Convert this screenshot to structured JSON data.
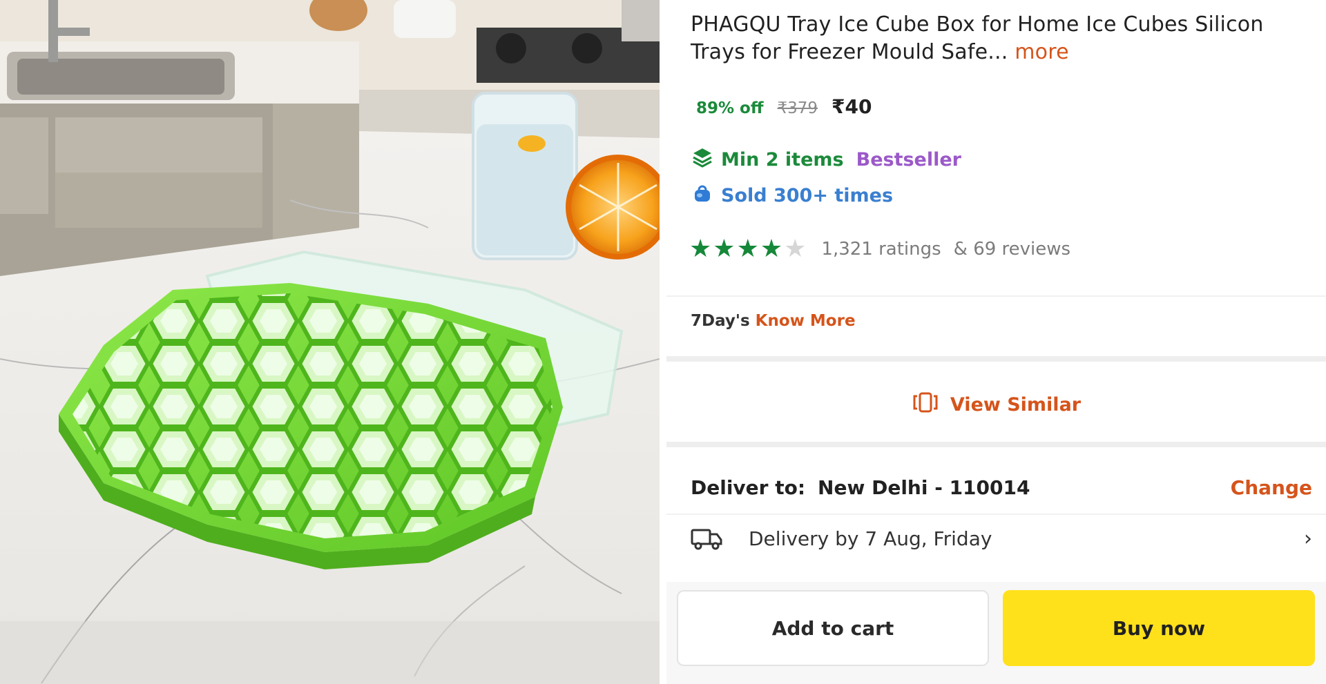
{
  "product": {
    "title": "PHAGQU Tray Ice Cube Box for Home Ice Cubes Silicon Trays for Freezer Mould Safe...",
    "more_label": "more",
    "image_alt": "Green honeycomb silicone ice cube tray on a marble kitchen counter"
  },
  "pricing": {
    "discount": "89% off",
    "mrp": "₹379",
    "price": "₹40"
  },
  "tags": {
    "min_items": "Min 2 items",
    "bestseller": "Bestseller",
    "sold": "Sold 300+ times"
  },
  "rating": {
    "stars": 4,
    "max_stars": 5,
    "ratings_count": "1,321 ratings",
    "reviews_count": "& 69 reviews"
  },
  "return_policy": {
    "label": "7Day's",
    "link": "Know More"
  },
  "view_similar": {
    "label": "View Similar",
    "icon": "view-similar-icon"
  },
  "delivery": {
    "deliver_to_label": "Deliver to:",
    "address": "New Delhi - 110014",
    "change_label": "Change",
    "date_text": "Delivery by 7 Aug, Friday",
    "icon": "truck-icon"
  },
  "actions": {
    "add_to_cart": "Add to cart",
    "buy_now": "Buy now"
  },
  "colors": {
    "accent_orange": "#d5541b",
    "green": "#1b8a3a",
    "purple": "#9b59c9",
    "blue": "#3a7fd0",
    "buy_yellow": "#ffe11b"
  }
}
